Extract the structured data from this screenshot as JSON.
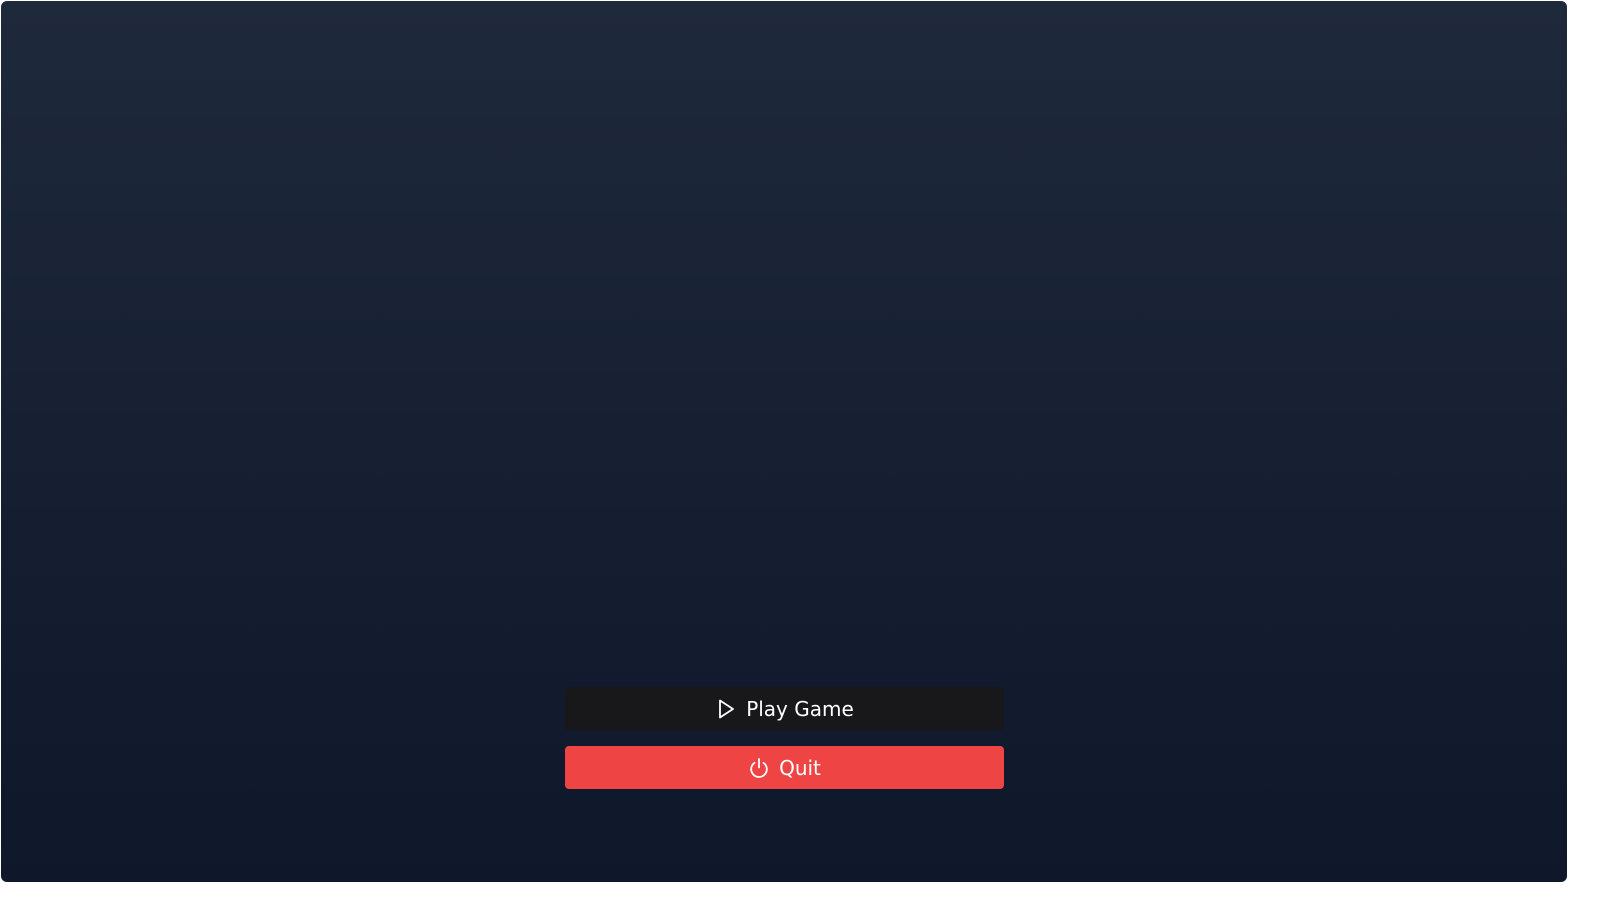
{
  "colors": {
    "background_top": "#1e293b",
    "background_bottom": "#0f172a",
    "play_button": "#18181b",
    "quit_button": "#ef4444",
    "text": "#ffffff"
  },
  "menu": {
    "play": {
      "label": "Play Game",
      "icon": "play-icon"
    },
    "quit": {
      "label": "Quit",
      "icon": "power-icon"
    }
  }
}
